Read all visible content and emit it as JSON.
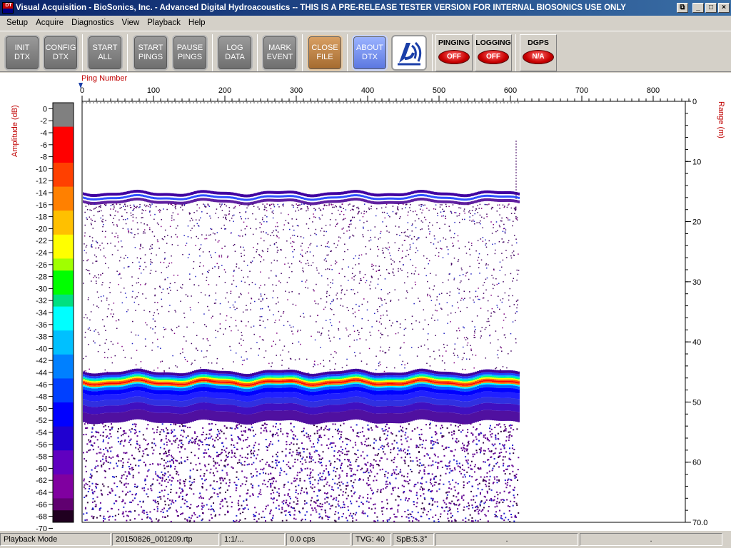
{
  "window": {
    "title": "Visual Acquisition  -  BioSonics, Inc.  -  Advanced Digital Hydroacoustics  -- THIS IS A PRE-RELEASE TESTER VERSION FOR INTERNAL BIOSONICS USE ONLY",
    "icon_text": "DT",
    "buttons": {
      "restore": "⧉",
      "minimize": "_",
      "maximize": "□",
      "close": "×"
    }
  },
  "menu": [
    {
      "label": "Setup"
    },
    {
      "label": "Acquire"
    },
    {
      "label": "Diagnostics"
    },
    {
      "label": "View"
    },
    {
      "label": "Playback"
    },
    {
      "label": "Help"
    }
  ],
  "toolbar": {
    "init_dtx": "INIT\nDTX",
    "config_dtx": "CONFIG\nDTX",
    "start_all": "START\nALL",
    "start_pings": "START\nPINGS",
    "pause_pings": "PAUSE\nPINGS",
    "log_data": "LOG\nDATA",
    "mark_event": "MARK\nEVENT",
    "close_file": "CLOSE\nFILE",
    "about_dtx": "ABOUT\nDTX"
  },
  "indicators": {
    "pinging": {
      "label": "PINGING",
      "value": "OFF"
    },
    "logging": {
      "label": "LOGGING",
      "value": "OFF"
    },
    "dgps": {
      "label": "DGPS",
      "value": "N/A"
    }
  },
  "echogram": {
    "ping_axis_label": "Ping Number",
    "ping_ticks": [
      "0",
      "100",
      "200",
      "300",
      "400",
      "500",
      "600",
      "700",
      "800"
    ],
    "range_axis_label": "Range (m)",
    "range_ticks": [
      "0",
      "10",
      "20",
      "30",
      "40",
      "50",
      "60",
      "70.0"
    ],
    "amplitude_label": "Amplitude (dB)",
    "amplitude_ticks": [
      "0",
      "-2",
      "-4",
      "-6",
      "-8",
      "-10",
      "-12",
      "-14",
      "-16",
      "-18",
      "-20",
      "-22",
      "-24",
      "-26",
      "-28",
      "-30",
      "-32",
      "-34",
      "-36",
      "-38",
      "-40",
      "-42",
      "-44",
      "-46",
      "-48",
      "-50",
      "-52",
      "-54",
      "-56",
      "-58",
      "-60",
      "-62",
      "-64",
      "-66",
      "-68",
      "-70"
    ],
    "label_color": "#c00000",
    "pings_recorded": 612,
    "ping_max": 850,
    "range_max_m": 70,
    "surface_layer_m": 17,
    "bottom_m": 47.5
  },
  "status": {
    "mode": "Playback Mode",
    "file": "20150826_001209.rtp",
    "ratio": "1:1/...",
    "rate": "0.0 cps",
    "tvg": "TVG: 40",
    "spb": "SpB:5.3°",
    "p1": ".",
    "p2": "."
  }
}
